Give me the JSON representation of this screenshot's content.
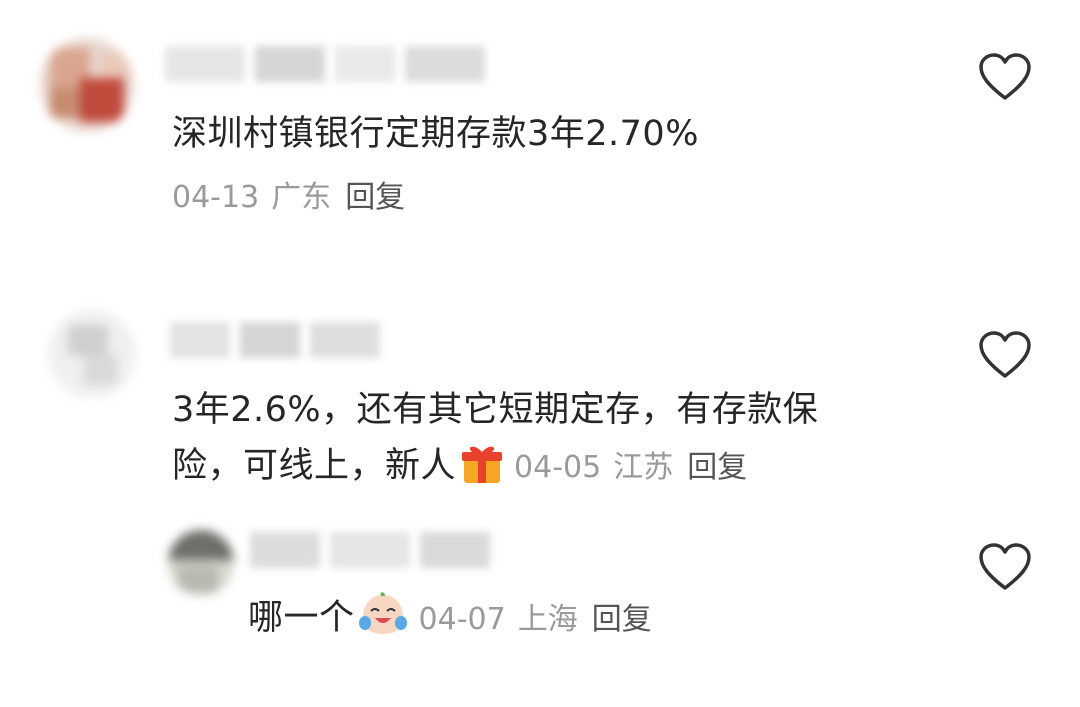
{
  "comments": [
    {
      "text": "深圳村镇银行定期存款3年2.70%",
      "date": "04-13",
      "location": "广东",
      "reply_label": "回复"
    },
    {
      "text_line1": "3年2.6%，还有其它短期定存，有存款保",
      "text_line2": "险，可线上，新人",
      "emoji": "gift-emoji",
      "date": "04-05",
      "location": "江苏",
      "reply_label": "回复"
    },
    {
      "text": "哪一个",
      "emoji": "crying-laughing-emoji",
      "date": "04-07",
      "location": "上海",
      "reply_label": "回复"
    }
  ],
  "colors": {
    "text": "#262626",
    "meta": "#9a9a9a",
    "reply": "#555555",
    "heart_stroke": "#333333"
  }
}
